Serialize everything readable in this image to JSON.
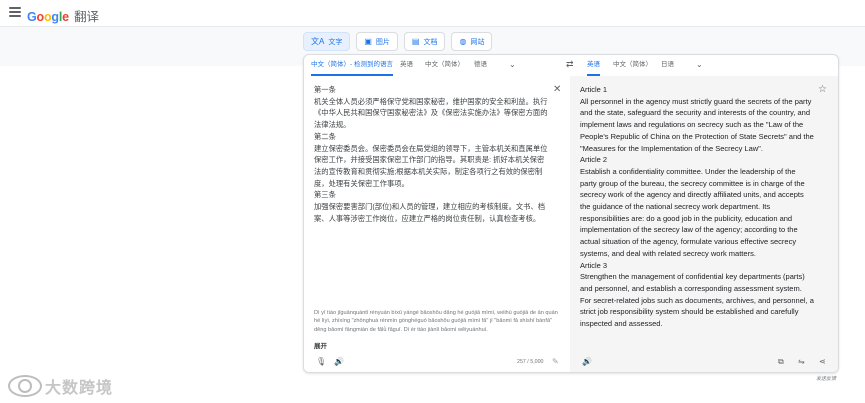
{
  "header": {
    "logo_letters": [
      "G",
      "o",
      "o",
      "g",
      "l",
      "e"
    ],
    "product": "翻译"
  },
  "modes": [
    {
      "label": "文字",
      "icon": "translate-icon"
    },
    {
      "label": "图片",
      "icon": "image-icon"
    },
    {
      "label": "文档",
      "icon": "document-icon"
    },
    {
      "label": "网站",
      "icon": "globe-icon"
    }
  ],
  "source_langs": [
    "中文（简体）- 检测到的语言",
    "英语",
    "中文（简体）",
    "德语"
  ],
  "target_langs": [
    "英语",
    "中文（简体）",
    "日语"
  ],
  "source": {
    "text": "第一条\n机关全体人员必须严格保守党和国家秘密，维护国家的安全和利益。执行《中华人民共和国保守国家秘密法》及《保密法实施办法》等保密方面的法律法规。\n第二条\n建立保密委员会。保密委员会在局党组的领导下，主管本机关和直属单位保密工作，并接受国家保密工作部门的指导。其职责是: 抓好本机关保密法的宣传教育和贯彻实施;根据本机关实际，制定各项行之有效的保密制度，处理有关保密工作事项。\n第三条\n加强保密要害部门(部位)和人员的管理，建立相应的考核制度。文书、档案、人事等涉密工作岗位，应建立严格的岗位责任制，认真检查考核。",
    "pinyin": "Dì yī tiáo jīguānquántǐ rényuán bìxū yángé bǎoshǒu dǎng hé guójiā mìmì, wéihù guójiā de ān quán hé lìyì, zhíxíng \"zhōnghuá rénmín gònghéguó bǎoshǒu guójiā mìmì fǎ\" jí \"bǎomì fǎ shíshī bànfǎ\" děng bǎomì fāngmiàn de fǎlǜ fǎguī. Dì èr tiáo jiànlì bǎomì wěiyuánhuì.",
    "collapse_label": "展开",
    "char_count": "257 / 5,000"
  },
  "target": {
    "text": "Article 1\nAll personnel in the agency must strictly guard the secrets of the party and the state, safeguard the security and interests of the country, and implement laws and regulations on secrecy such as the \"Law of the People's Republic of China on the Protection of State Secrets\" and the \"Measures for the Implementation of the Secrecy Law\".\nArticle 2\nEstablish a confidentiality committee. Under the leadership of the party group of the bureau, the secrecy committee is in charge of the secrecy work of the agency and directly affiliated units, and accepts the guidance of the national secrecy work department. Its responsibilities are: do a good job in the publicity, education and implementation of the secrecy law of the agency; according to the actual situation of the agency, formulate various effective secrecy systems, and deal with related secrecy work matters.\nArticle 3\nStrengthen the management of confidential key departments (parts) and personnel, and establish a corresponding assessment system. For secret-related jobs such as documents, archives, and personnel, a strict job responsibility system should be established and carefully inspected and assessed."
  },
  "footer": {
    "feedback": "发送反馈",
    "watermark": "大数跨境"
  },
  "colors": {
    "accent": "#1a73e8",
    "active_tab_bg": "#e8f0fe",
    "target_bg": "#f5f5f5"
  }
}
